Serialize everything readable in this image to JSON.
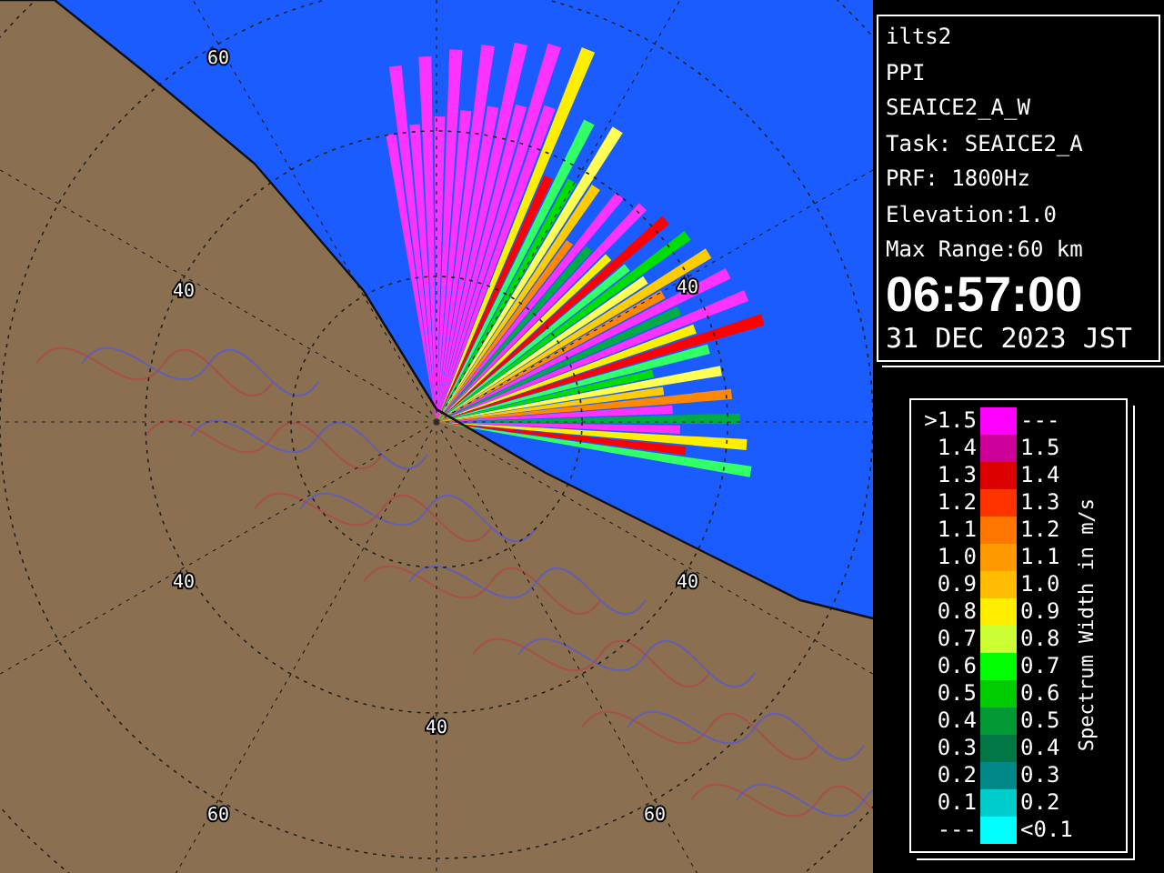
{
  "radar_map": {
    "range_labels": [
      "60",
      "40",
      "40",
      "40",
      "40",
      "40",
      "60",
      "60"
    ]
  },
  "info": {
    "lines": [
      "ilts2",
      "PPI",
      "SEAICE2_A_W",
      "Task: SEAICE2_A",
      "PRF: 1800Hz",
      "Elevation:1.0",
      "Max Range:60 km"
    ],
    "time": "06:57:00",
    "date": "31 DEC 2023 JST"
  },
  "legend": {
    "title": "Spectrum Width in m/s",
    "rows": [
      {
        "low": ">1.5",
        "high": "---",
        "color": "#ff00ff"
      },
      {
        "low": "1.4",
        "high": "1.5",
        "color": "#cc0099"
      },
      {
        "low": "1.3",
        "high": "1.4",
        "color": "#dd0000"
      },
      {
        "low": "1.2",
        "high": "1.3",
        "color": "#ff3300"
      },
      {
        "low": "1.1",
        "high": "1.2",
        "color": "#ff7700"
      },
      {
        "low": "1.0",
        "high": "1.1",
        "color": "#ff9900"
      },
      {
        "low": "0.9",
        "high": "1.0",
        "color": "#ffbb00"
      },
      {
        "low": "0.8",
        "high": "0.9",
        "color": "#ffee00"
      },
      {
        "low": "0.7",
        "high": "0.8",
        "color": "#ccff33"
      },
      {
        "low": "0.6",
        "high": "0.7",
        "color": "#00ff00"
      },
      {
        "low": "0.5",
        "high": "0.6",
        "color": "#00cc00"
      },
      {
        "low": "0.4",
        "high": "0.5",
        "color": "#009933"
      },
      {
        "low": "0.3",
        "high": "0.4",
        "color": "#007744"
      },
      {
        "low": "0.2",
        "high": "0.3",
        "color": "#008888"
      },
      {
        "low": "0.1",
        "high": "0.2",
        "color": "#00cccc"
      },
      {
        "low": "---",
        "high": "<0.1",
        "color": "#00ffff"
      }
    ]
  }
}
